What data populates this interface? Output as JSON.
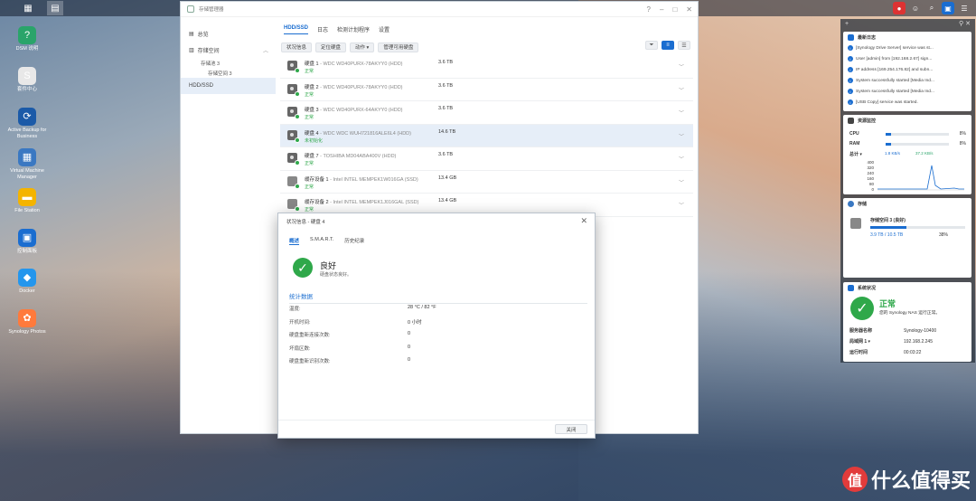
{
  "desktop": {
    "icons": [
      {
        "label": "DSM 说明",
        "icon": "help-icon",
        "color": "#2aa46a"
      },
      {
        "label": "套件中心",
        "icon": "package-center-icon",
        "color": "#e8e8e8"
      },
      {
        "label": "Active Backup for Business",
        "icon": "backup-icon",
        "color": "#1b5aa8"
      },
      {
        "label": "Virtual Machine Manager",
        "icon": "vm-icon",
        "color": "#3a78c2"
      },
      {
        "label": "File Station",
        "icon": "folder-icon",
        "color": "#f4b400"
      },
      {
        "label": "控制面板",
        "icon": "control-panel-icon",
        "color": "#1a6dd0"
      },
      {
        "label": "Docker",
        "icon": "docker-icon",
        "color": "#2496ed"
      },
      {
        "label": "Synology Photos",
        "icon": "photos-icon",
        "color": "#ff7a3c"
      }
    ]
  },
  "window": {
    "title": "存储管理器",
    "sidebar": {
      "overview": "总览",
      "storage": "存储空间",
      "pool": "存储池 3",
      "volume": "存储空间 3",
      "hdd": "HDD/SSD"
    },
    "tabs": [
      "HDD/SSD",
      "日志",
      "检测计划程序",
      "设置"
    ],
    "toolbar": [
      "状况信息",
      "定位硬盘",
      "动作 ▾",
      "管理可用硬盘"
    ],
    "disks": [
      {
        "name": "硬盘 1",
        "model": " - WDC WD40PURX-78AKYY0 (HDD)",
        "status": "正常",
        "size": "3.6 TB",
        "type": "hdd"
      },
      {
        "name": "硬盘 2",
        "model": " - WDC WD40PURX-78AKYY0 (HDD)",
        "status": "正常",
        "size": "3.6 TB",
        "type": "hdd"
      },
      {
        "name": "硬盘 3",
        "model": " - WDC WD40PURX-64AKYY0 (HDD)",
        "status": "正常",
        "size": "3.6 TB",
        "type": "hdd"
      },
      {
        "name": "硬盘 4",
        "model": " - WDC WDC WUH721816ALE6L4 (HDD)",
        "status": "未初始化",
        "size": "14.6 TB",
        "type": "hdd"
      },
      {
        "name": "硬盘 7",
        "model": " - TOSHIBA MD04ABA400V (HDD)",
        "status": "正常",
        "size": "3.6 TB",
        "type": "hdd"
      },
      {
        "name": "缓存设备 1",
        "model": " - Intel INTEL MEMPEK1W016GA (SSD)",
        "status": "正常",
        "size": "13.4 GB",
        "type": "ssd"
      },
      {
        "name": "缓存设备 2",
        "model": " - Intel INTEL MEMPEK1J016GAL (SSD)",
        "status": "正常",
        "size": "13.4 GB",
        "type": "ssd"
      }
    ]
  },
  "dialog": {
    "title": "状况信息 - 硬盘 4",
    "tabs": [
      "概述",
      "S.M.A.R.T.",
      "历史纪录"
    ],
    "status_title": "良好",
    "status_desc": "硬盘状态良好。",
    "stats_heading": "统计数据",
    "stats": [
      {
        "label": "温度:",
        "value": "28 °C / 82 °F"
      },
      {
        "label": "开机时间:",
        "value": "0 小时"
      },
      {
        "label": "硬盘重新连接次数:",
        "value": "0"
      },
      {
        "label": "坏扇区数:",
        "value": "0"
      },
      {
        "label": "硬盘重新识别次数:",
        "value": "0"
      }
    ],
    "close_label": "关闭"
  },
  "widgets": {
    "log": {
      "title": "最新日志",
      "entries": [
        "[Synology Drive Server] service was st...",
        "User [admin] from [192.168.2.67] sign...",
        "IP address [169.254.176.82] and subn...",
        "System successfully started [Media Ind...",
        "System successfully started [Media Ind...",
        "[USB Copy] service was started."
      ]
    },
    "resource": {
      "title": "资源监控",
      "cpu_label": "CPU",
      "cpu_pct": "8%",
      "cpu_value": 0.08,
      "ram_label": "RAM",
      "ram_pct": "8%",
      "ram_value": 0.08,
      "net_label": "总计 ▾",
      "up": "1.8 KB/s",
      "down": "37.2 KB/s",
      "axis": [
        "400",
        "320",
        "240",
        "160",
        "80",
        "0"
      ]
    },
    "storage": {
      "title": "存储",
      "name": "存储空间 3 (良好)",
      "used": "3.9 TB / 10.5 TB",
      "pct": "38%",
      "pct_value": 0.38
    },
    "health": {
      "title": "系统状况",
      "status": "正常",
      "desc": "您的 Synology NAS 运行正常。",
      "rows": [
        {
          "k": "服务器名称",
          "v": "Synology-10400"
        },
        {
          "k": "局域网 1 ▾",
          "v": "192.168.2.245"
        },
        {
          "k": "运行时间",
          "v": "00:03:22"
        }
      ]
    }
  },
  "watermark": {
    "text": "什么值得买",
    "badge": "值"
  }
}
